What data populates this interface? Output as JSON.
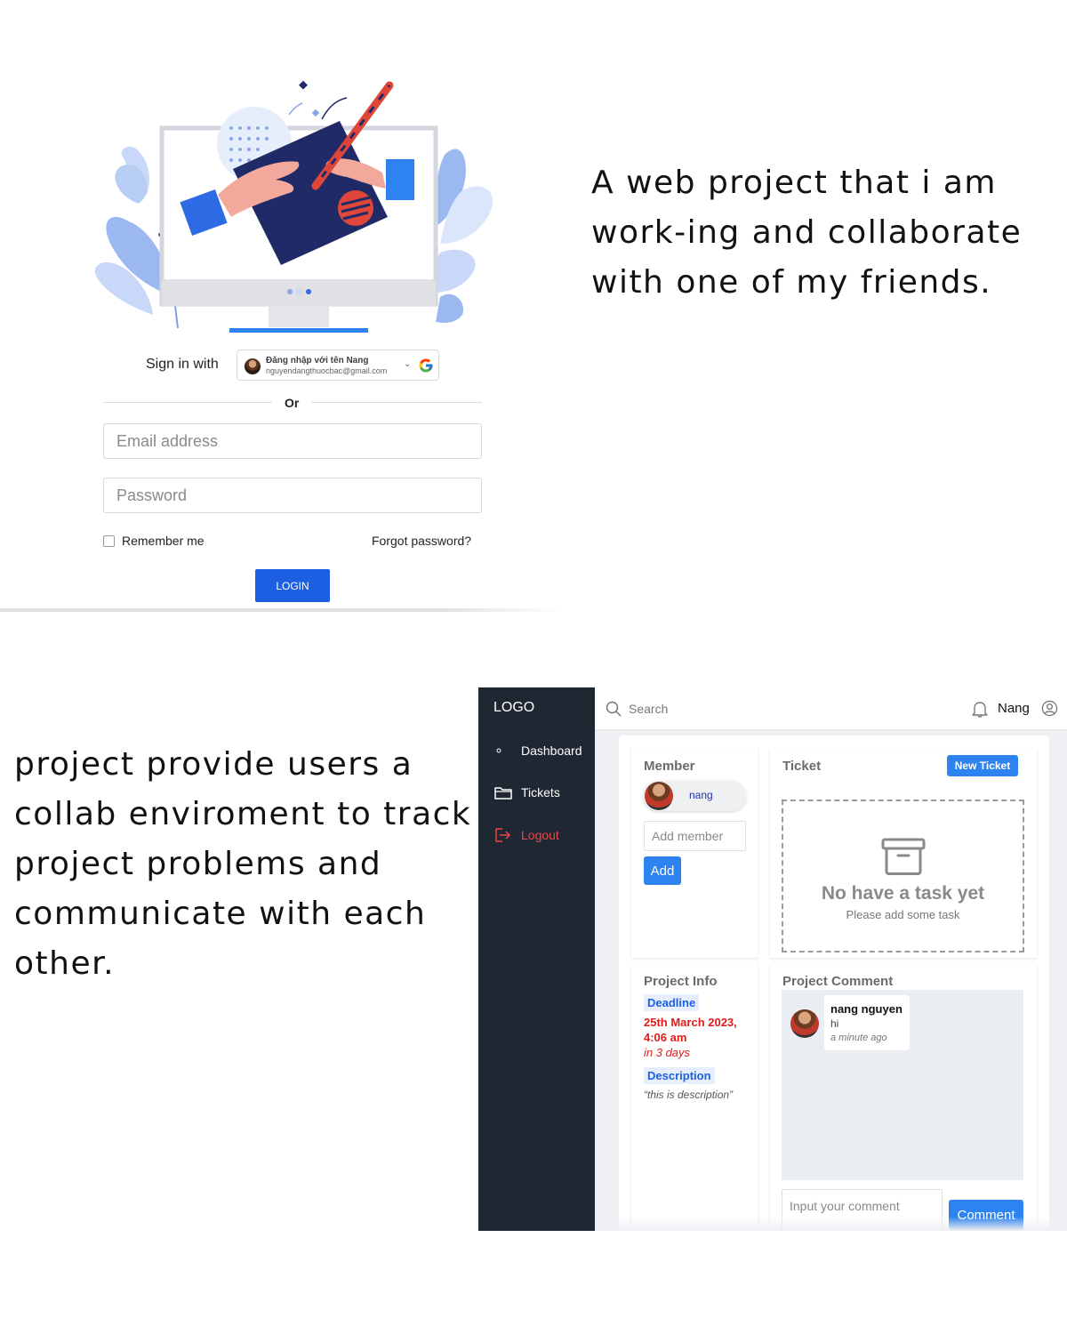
{
  "login": {
    "signin_label": "Sign in with",
    "google": {
      "name": "Đăng nhập với tên Nang",
      "email": "nguyendangthuocbac@gmail.com",
      "icon": "google-g-icon"
    },
    "or_label": "Or",
    "email_placeholder": "Email address",
    "password_placeholder": "Password",
    "remember_label": "Remember me",
    "forgot_label": "Forgot password?",
    "login_label": "LOGIN",
    "accent_color": "#1c5fe3"
  },
  "captions": {
    "top": "A web project that i am work-ing and collaborate with one of my friends.",
    "bottom": "project provide users a collab enviroment to track project problems and communicate with each other."
  },
  "dashboard": {
    "logo": "LOGO",
    "nav": [
      {
        "label": "Dashboard",
        "icon": "dot-icon"
      },
      {
        "label": "Tickets",
        "icon": "folder-icon"
      },
      {
        "label": "Logout",
        "icon": "logout-icon"
      }
    ],
    "search_placeholder": "Search",
    "username": "Nang",
    "member": {
      "title": "Member",
      "members": [
        "nang"
      ],
      "add_placeholder": "Add member",
      "add_label": "Add"
    },
    "ticket": {
      "title": "Ticket",
      "new_label": "New Ticket",
      "empty_title": "No have a task yet",
      "empty_subtitle": "Please add some task"
    },
    "project_info": {
      "title": "Project Info",
      "deadline_label": "Deadline",
      "deadline_value": "25th March 2023, 4:06 am",
      "deadline_relative": "in 3 days",
      "description_label": "Description",
      "description_value": "“this is description”"
    },
    "project_comment": {
      "title": "Project Comment",
      "comments": [
        {
          "author": "nang nguyen",
          "text": "hi",
          "time": "a minute ago"
        }
      ],
      "input_placeholder": "Input your comment",
      "submit_label": "Comment"
    },
    "colors": {
      "sidebar": "#1f2733",
      "primary": "#2d83f0",
      "danger": "#e01b1b"
    }
  }
}
